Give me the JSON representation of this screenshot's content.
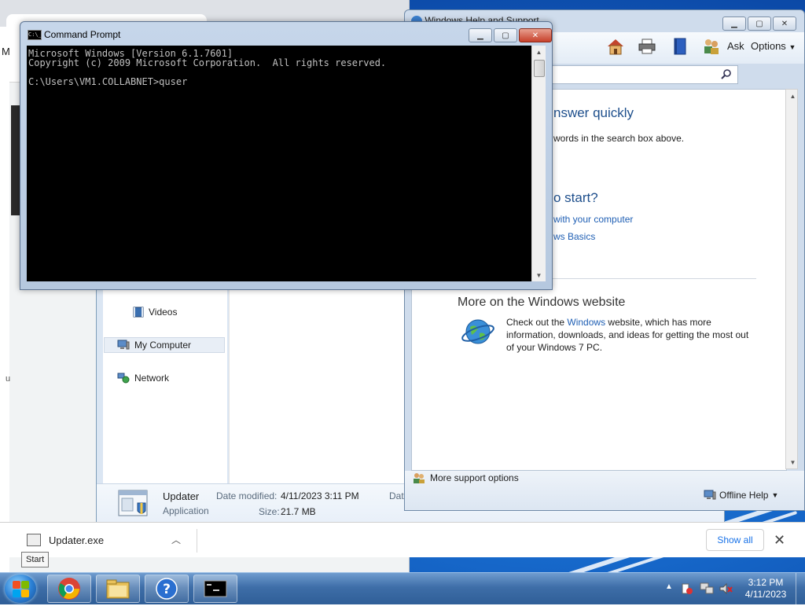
{
  "chrome_bg": {
    "partial_letter": "M",
    "partial_letter_u": "u"
  },
  "explorer": {
    "nav": {
      "videos": "Videos",
      "my_computer": "My Computer",
      "network": "Network"
    },
    "details": {
      "name": "Updater",
      "type": "Application",
      "date_modified_label": "Date modified:",
      "date_modified_value": "4/11/2023 3:11 PM",
      "size_label": "Size:",
      "size_value": "21.7 MB",
      "date_label_partial": "Date"
    }
  },
  "help": {
    "title_partial": "Windows Help and Support",
    "toolbar": {
      "ask": "Ask",
      "options": "Options"
    },
    "heading_answer": "nswer quickly",
    "search_hint": "words in the search box above.",
    "heading_start": "o start?",
    "link_computer": "with your computer",
    "link_basics": "ws Basics",
    "more_heading": "More on the Windows website",
    "para_prefix": "Check out the ",
    "para_link": "Windows",
    "para_suffix": " website, which has more information, downloads, and ideas for getting the most out of your Windows 7 PC.",
    "more_support": "More support options",
    "offline_help": "Offline Help"
  },
  "cmd": {
    "title": "Command Prompt",
    "icon_text": "C:\\_",
    "lines": [
      "Microsoft Windows [Version 6.1.7601]",
      "Copyright (c) 2009 Microsoft Corporation.  All rights reserved.",
      "",
      "C:\\Users\\VM1.COLLABNET>quser"
    ]
  },
  "download_bar": {
    "file_name": "Updater.exe",
    "show_all": "Show all"
  },
  "tooltip": {
    "start": "Start"
  },
  "taskbar": {
    "time": "3:12 PM",
    "date": "4/11/2023"
  },
  "colors": {
    "cmd_text": "#c0c0c0",
    "link": "#1f5fb4",
    "show_all": "#1a73e8"
  }
}
